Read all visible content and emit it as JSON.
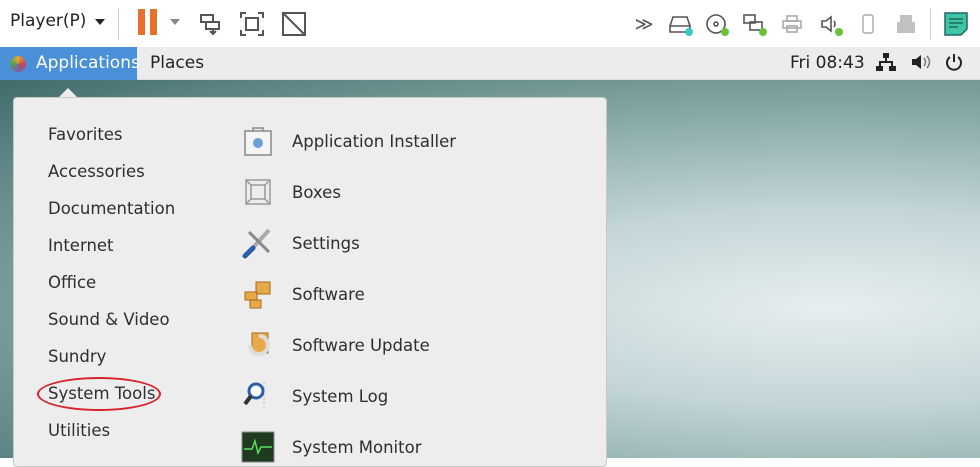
{
  "toolbar": {
    "player_label": "Player(P)",
    "icons": [
      "pause-icon",
      "send-ctrl-alt-del-icon",
      "fullscreen-icon",
      "unity-icon",
      "more-icon",
      "hard-disk-icon",
      "cd-dvd-icon",
      "network-adapter-icon",
      "printer-icon",
      "sound-card-icon",
      "phone-device-icon",
      "usb-icon",
      "notes-icon"
    ]
  },
  "topbar": {
    "applications": "Applications",
    "places": "Places",
    "clock": "Fri 08:43"
  },
  "menu": {
    "categories": [
      "Favorites",
      "Accessories",
      "Documentation",
      "Internet",
      "Office",
      "Sound & Video",
      "Sundry",
      "System Tools",
      "Utilities"
    ],
    "highlighted_category": "System Tools",
    "apps": [
      {
        "label": "Application Installer",
        "icon": "application-installer-icon"
      },
      {
        "label": "Boxes",
        "icon": "boxes-icon"
      },
      {
        "label": "Settings",
        "icon": "settings-icon"
      },
      {
        "label": "Software",
        "icon": "software-icon"
      },
      {
        "label": "Software Update",
        "icon": "software-update-icon"
      },
      {
        "label": "System Log",
        "icon": "system-log-icon"
      },
      {
        "label": "System Monitor",
        "icon": "system-monitor-icon"
      }
    ]
  },
  "colors": {
    "accent": "#4a90d9",
    "pause": "#e8702a",
    "annotation": "#d8232a"
  }
}
